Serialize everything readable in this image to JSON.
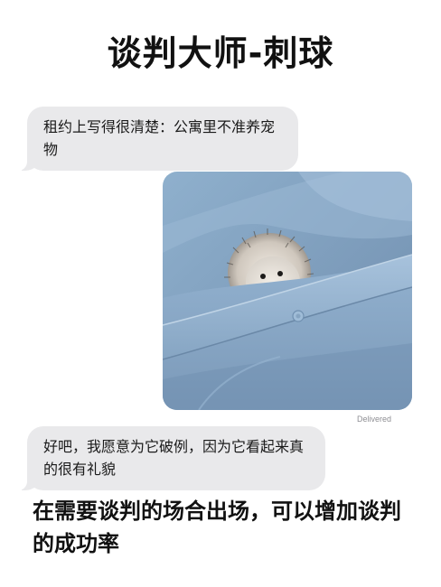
{
  "title": "谈判大师-刺球",
  "messages": [
    {
      "text": "租约上写得很清楚：公寓里不准养宠物"
    },
    {
      "text": "好吧，我愿意为它破例，因为它看起来真的很有礼貌"
    }
  ],
  "photo": {
    "subject": "hedgehog-in-pocket",
    "status": "Delivered"
  },
  "caption": "在需要谈判的场合出场，可以增加谈判的成功率",
  "colors": {
    "bubble": "#e9e9eb",
    "background": "#ffffff",
    "text": "#111111",
    "fabric": "#7f9dbb"
  }
}
